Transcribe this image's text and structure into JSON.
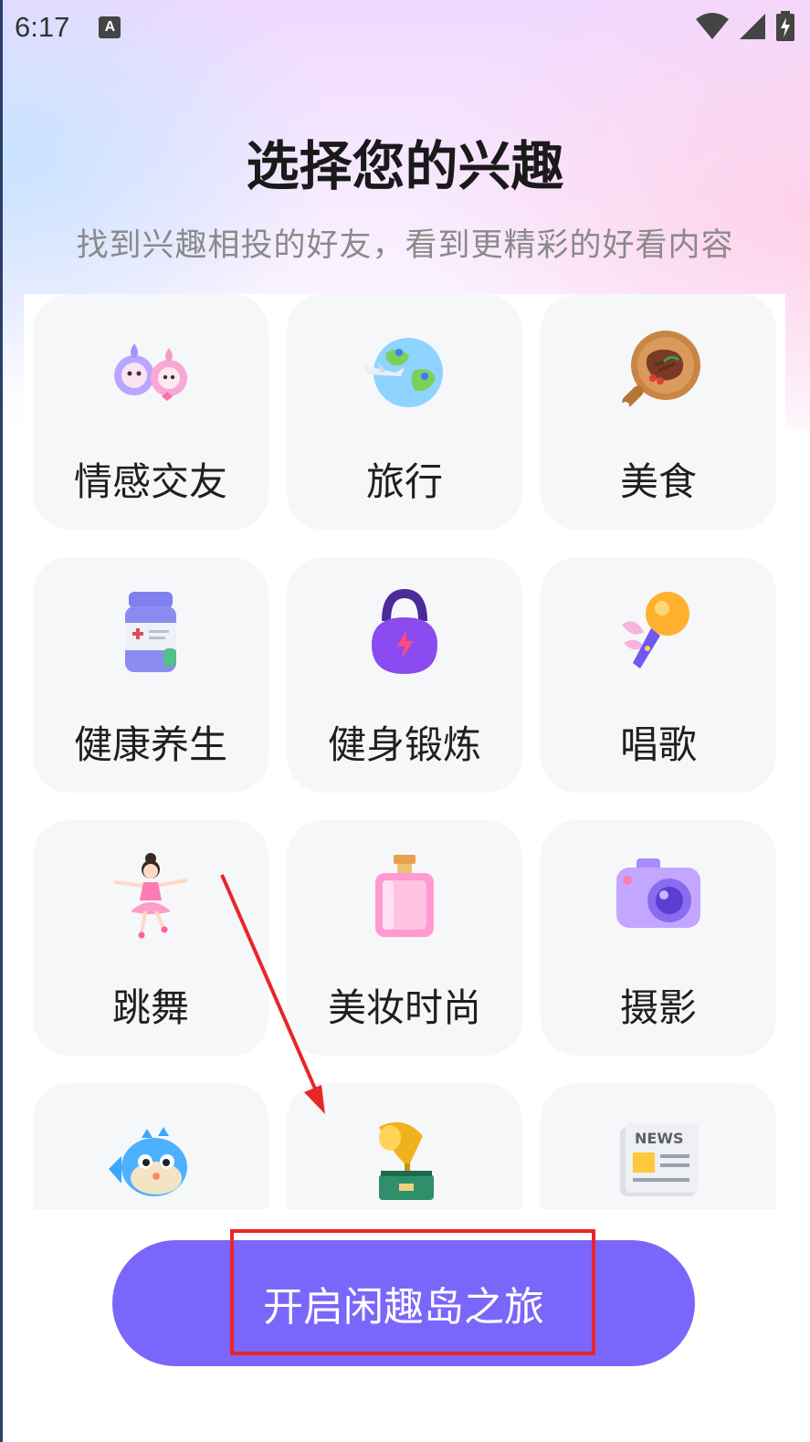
{
  "status_bar": {
    "time": "6:17",
    "notification_icon_label": "A",
    "icons": [
      "wifi-icon",
      "signal-icon",
      "battery-charging-icon"
    ]
  },
  "header": {
    "title": "选择您的兴趣",
    "subtitle": "找到兴趣相投的好友，看到更精彩的好看内容"
  },
  "interests": [
    {
      "label": "情感交友",
      "icon": "couple-mascot-icon"
    },
    {
      "label": "旅行",
      "icon": "globe-plane-icon"
    },
    {
      "label": "美食",
      "icon": "steak-board-icon"
    },
    {
      "label": "健康养生",
      "icon": "medicine-bottle-icon"
    },
    {
      "label": "健身锻炼",
      "icon": "kettlebell-icon"
    },
    {
      "label": "唱歌",
      "icon": "microphone-icon"
    },
    {
      "label": "跳舞",
      "icon": "ballerina-icon"
    },
    {
      "label": "美妆时尚",
      "icon": "perfume-bottle-icon"
    },
    {
      "label": "摄影",
      "icon": "camera-icon"
    },
    {
      "label": "",
      "icon": "pufferfish-icon"
    },
    {
      "label": "",
      "icon": "gramophone-icon"
    },
    {
      "label": "",
      "icon": "newspaper-icon",
      "icon_text": "NEWS"
    }
  ],
  "actions": {
    "start_label": "开启闲趣岛之旅"
  },
  "colors": {
    "accent": "#7b66fb",
    "annotation_red": "#e8262a",
    "card_bg": "#f6f7f9"
  }
}
